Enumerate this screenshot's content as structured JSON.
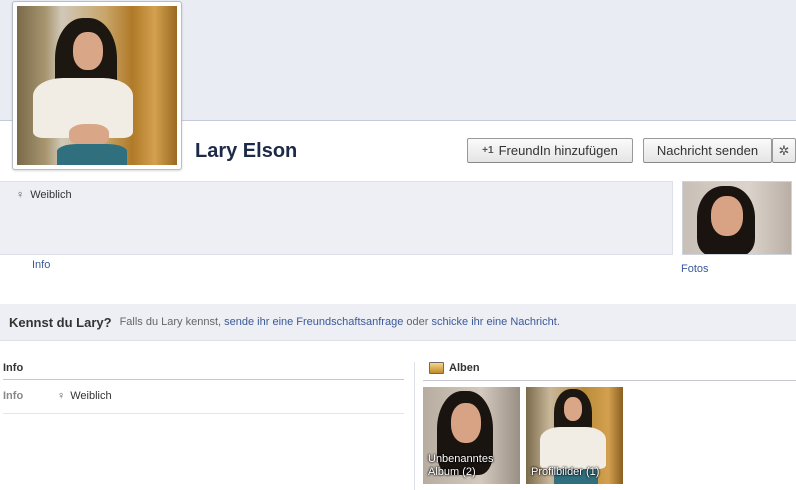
{
  "profile": {
    "name": "Lary Elson",
    "gender": "Weiblich"
  },
  "actions": {
    "add_friend_label": "FreundIn hinzufügen",
    "add_friend_icon": "+1",
    "message_label": "Nachricht senden",
    "settings_icon": "gear-icon"
  },
  "tabs": {
    "info_label": "Info",
    "fotos_label": "Fotos"
  },
  "kennst": {
    "title": "Kennst du Lary?",
    "text_before": "Falls du Lary kennst,",
    "link_friend_request": "sende ihr eine Freundschaftsanfrage",
    "text_or": "oder",
    "link_message": "schicke ihr eine Nachricht",
    "text_end": "."
  },
  "info_section": {
    "title": "Info",
    "key": "Info",
    "value": "Weiblich"
  },
  "albums_section": {
    "title": "Alben",
    "albums": [
      {
        "label_line1": "Unbenanntes",
        "label_line2": "Album (2)"
      },
      {
        "label_line1": "Profilbilder (1)"
      }
    ]
  },
  "colors": {
    "link": "#3b5998",
    "name": "#1c2a47",
    "strip": "#edeff4"
  }
}
